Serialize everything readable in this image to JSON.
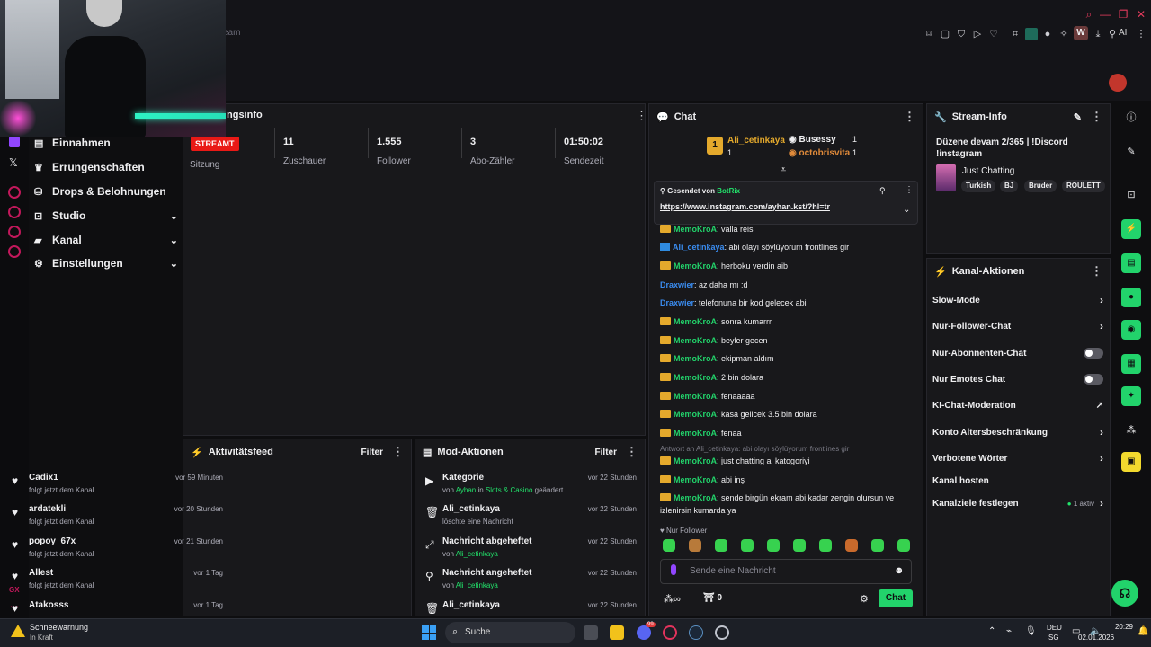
{
  "browser": {
    "tab_fragment": "eam",
    "ext_label": "AI",
    "w_badge": "W"
  },
  "stream_stats": {
    "section_title": "ngsinfo",
    "live_badge": "STREAMT",
    "items": [
      {
        "value": "",
        "label": "Sitzung"
      },
      {
        "value": "11",
        "label": "Zuschauer"
      },
      {
        "value": "1.555",
        "label": "Follower"
      },
      {
        "value": "3",
        "label": "Abo-Zähler"
      },
      {
        "value": "01:50:02",
        "label": "Sendezeit"
      }
    ]
  },
  "nav": {
    "items": [
      {
        "label": "Einnahmen",
        "icon": "earnings-icon"
      },
      {
        "label": "Errungenschaften",
        "icon": "trophy-icon"
      },
      {
        "label": "Drops & Belohnungen",
        "icon": "gift-icon"
      },
      {
        "label": "Studio",
        "icon": "studio-icon"
      },
      {
        "label": "Kanal",
        "icon": "channel-icon"
      },
      {
        "label": "Einstellungen",
        "icon": "gear-icon"
      }
    ]
  },
  "activity": {
    "title": "Aktivitätsfeed",
    "filter": "Filter",
    "rows": [
      {
        "name": "Cadix1",
        "sub": "folgt jetzt dem Kanal",
        "time": "vor 59 Minuten"
      },
      {
        "name": "ardatekli",
        "sub": "folgt jetzt dem Kanal",
        "time": "vor 20 Stunden"
      },
      {
        "name": "popoy_67x",
        "sub": "folgt jetzt dem Kanal",
        "time": "vor 21 Stunden"
      },
      {
        "name": "Allest",
        "sub": "folgt jetzt dem Kanal",
        "time": "vor 1 Tag"
      },
      {
        "name": "Atakosss",
        "sub": "",
        "time": "vor 1 Tag"
      }
    ]
  },
  "mod": {
    "title": "Mod-Aktionen",
    "filter": "Filter",
    "rows": [
      {
        "name": "Kategorie",
        "sub_pre": "von",
        "sub_user": "Ayhan",
        "sub_mid": "in",
        "sub_cat": "Slots & Casino",
        "sub_post": "geändert",
        "time": "vor 22 Stunden"
      },
      {
        "name": "Ali_cetinkaya",
        "sub_pre": "löschte eine Nachricht",
        "sub_user": "",
        "sub_mid": "",
        "sub_cat": "",
        "sub_post": "",
        "time": "vor 22 Stunden"
      },
      {
        "name": "Nachricht abgeheftet",
        "sub_pre": "von",
        "sub_user": "Ali_cetinkaya",
        "sub_mid": "",
        "sub_cat": "",
        "sub_post": "",
        "time": "vor 22 Stunden"
      },
      {
        "name": "Nachricht angeheftet",
        "sub_pre": "von",
        "sub_user": "Ali_cetinkaya",
        "sub_mid": "",
        "sub_cat": "",
        "sub_post": "",
        "time": "vor 22 Stunden"
      },
      {
        "name": "Ali_cetinkaya",
        "sub_pre": "",
        "sub_user": "",
        "sub_mid": "",
        "sub_cat": "",
        "sub_post": "",
        "time": "vor 22 Stunden"
      }
    ]
  },
  "chat": {
    "title": "Chat",
    "leader1": {
      "name": "Ali_cetinkaya",
      "count": "1",
      "rank": "1"
    },
    "leader2": {
      "name": "Busessy",
      "count": "1"
    },
    "leader3": {
      "name": "octobrisvita",
      "count": "1"
    },
    "pinned": {
      "by_label": "Gesendet von",
      "by_user": "BotRix",
      "link": "https://www.instagram.com/ayhan.kst/?hl=tr"
    },
    "messages": [
      {
        "user": "MemoKroA",
        "text": ": valla reis",
        "cls": "memo",
        "badge": "crown"
      },
      {
        "user": "Ali_cetinkaya",
        "text": ": abi olayı söylüyorum frontlines gir",
        "cls": "ali",
        "badge": "blue"
      },
      {
        "user": "MemoKroA",
        "text": ": herboku verdin aib",
        "cls": "memo",
        "badge": "crown"
      },
      {
        "user": "Draxwier",
        "text": ": az daha mı :d",
        "cls": "drax",
        "badge": ""
      },
      {
        "user": "Draxwier",
        "text": ": telefonuna bir kod gelecek abi",
        "cls": "drax",
        "badge": ""
      },
      {
        "user": "MemoKroA",
        "text": ": sonra kumarrr",
        "cls": "memo",
        "badge": "crown"
      },
      {
        "user": "MemoKroA",
        "text": ": beyler gecen",
        "cls": "memo",
        "badge": "crown"
      },
      {
        "user": "MemoKroA",
        "text": ": ekipman aldım",
        "cls": "memo",
        "badge": "crown"
      },
      {
        "user": "MemoKroA",
        "text": ": 2 bin dolara",
        "cls": "memo",
        "badge": "crown"
      },
      {
        "user": "MemoKroA",
        "text": ": fenaaaaa",
        "cls": "memo",
        "badge": "crown"
      },
      {
        "user": "MemoKroA",
        "text": ": kasa gelicek 3.5 bin dolara",
        "cls": "memo",
        "badge": "crown"
      },
      {
        "user": "MemoKroA",
        "text": ": fenaa",
        "cls": "memo",
        "badge": "crown"
      }
    ],
    "reply_note": "Antwort an Ali_cetinkaya: abi olayı söylüyorum frontlines gir",
    "messages2": [
      {
        "user": "MemoKroA",
        "text": ": just chatting al katogoriyi"
      },
      {
        "user": "MemoKroA",
        "text": ": abi inş"
      },
      {
        "user": "MemoKroA",
        "text": ": sende birgün ekram abi kadar zengin olursun ve"
      }
    ],
    "msg_cont": "izlenirsin kumarda ya",
    "follower_only": "Nur Follower",
    "input_placeholder": "Sende eine Nachricht",
    "points": "0",
    "send_label": "Chat"
  },
  "stream_info": {
    "title": "Stream-Info",
    "stream_title": "Düzene devam 2/365 | !Discord !instagram",
    "category": "Just Chatting",
    "tags": [
      "Turkish",
      "BJ",
      "Bruder",
      "ROULETT"
    ]
  },
  "channel_actions": {
    "title": "Kanal-Aktionen",
    "rows": [
      {
        "label": "Slow-Mode",
        "kind": "arrow"
      },
      {
        "label": "Nur-Follower-Chat",
        "kind": "arrow"
      },
      {
        "label": "Nur-Abonnenten-Chat",
        "kind": "toggle"
      },
      {
        "label": "Nur Emotes Chat",
        "kind": "toggle"
      },
      {
        "label": "KI-Chat-Moderation",
        "kind": "ext"
      },
      {
        "label": "Konto Altersbeschränkung",
        "kind": "arrow"
      },
      {
        "label": "Verbotene Wörter",
        "kind": "arrow"
      },
      {
        "label": "Kanal hosten",
        "kind": "none"
      },
      {
        "label": "Kanalziele festlegen",
        "kind": "arrow",
        "badge": "1 aktiv"
      }
    ]
  },
  "taskbar": {
    "weather_title": "Schneewarnung",
    "weather_sub": "In Kraft",
    "search": "Suche",
    "lang1": "DEU",
    "lang2": "SG",
    "time": "20:29",
    "date": "02.01.2026",
    "badge99": "99"
  },
  "left_rail": {
    "gx": "GX"
  }
}
